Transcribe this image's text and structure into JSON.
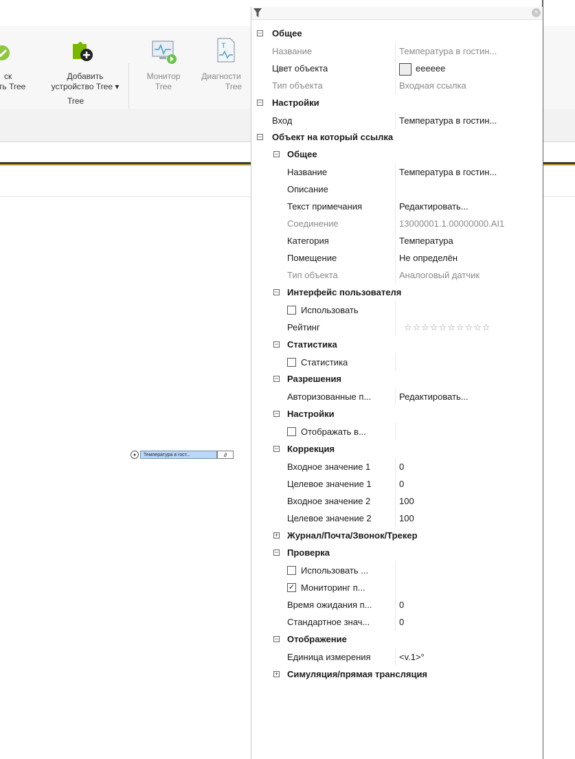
{
  "ribbon": {
    "btn_search_line1": "ск",
    "btn_search_line2": "ть Tree",
    "btn_add_line1": "Добавить",
    "btn_add_line2": "устройство Tree ▾",
    "btn_monitor_line1": "Монитор",
    "btn_monitor_line2": "Tree",
    "btn_diag_line1": "Диагности",
    "btn_diag_line2": "Tree",
    "group_label": "Tree"
  },
  "canvas": {
    "node_label": "Температура в гост...",
    "node_value": "∂"
  },
  "panel": {
    "filter_placeholder": "",
    "sections": {
      "general": "Общее",
      "settings": "Настройки",
      "ref_object": "Объект на который ссылка",
      "ref_general": "Общее",
      "ui": "Интерфейс пользователя",
      "stats": "Статистика",
      "perms": "Разрешения",
      "ref_settings": "Настройки",
      "correction": "Коррекция",
      "journal": "Журнал/Почта/Звонок/Трекер",
      "check": "Проверка",
      "display": "Отображение",
      "simulation": "Симуляция/прямая трансляция"
    },
    "props": {
      "name_label": "Название",
      "name_value": "Температура в гостин...",
      "color_label": "Цвет объекта",
      "color_value": "eeeeee",
      "color_hex": "#eeeeee",
      "type_label": "Тип объекта",
      "type_value": "Входная ссылка",
      "input_label": "Вход",
      "input_value": "Температура в гостин...",
      "ref_name_label": "Название",
      "ref_name_value": "Температура в гостин...",
      "desc_label": "Описание",
      "desc_value": "",
      "note_label": "Текст примечания",
      "note_value": "Редактировать...",
      "conn_label": "Соединение",
      "conn_value": "13000001.1.00000000.AI1",
      "cat_label": "Категория",
      "cat_value": "Температура",
      "room_label": "Помещение",
      "room_value": "Не определён",
      "reftype_label": "Тип объекта",
      "reftype_value": "Аналоговый датчик",
      "use_label": "Использовать",
      "rating_label": "Рейтинг",
      "rating_stars": "☆☆☆☆☆☆☆☆☆☆",
      "stats_label": "Статистика",
      "auth_label": "Авторизованные п...",
      "auth_value": "Редактировать...",
      "show_label": "Отображать в...",
      "in1_label": "Входное значение 1",
      "in1_value": "0",
      "tg1_label": "Целевое значение 1",
      "tg1_value": "0",
      "in2_label": "Входное значение 2",
      "in2_value": "100",
      "tg2_label": "Целевое значение 2",
      "tg2_value": "100",
      "chk_use_label": "Использовать ...",
      "chk_mon_label": "Мониторинг п...",
      "wait_label": "Время ожидания п...",
      "wait_value": "0",
      "std_label": "Стандартное знач...",
      "std_value": "0",
      "unit_label": "Единица измерения",
      "unit_value": "<v.1>°"
    }
  }
}
